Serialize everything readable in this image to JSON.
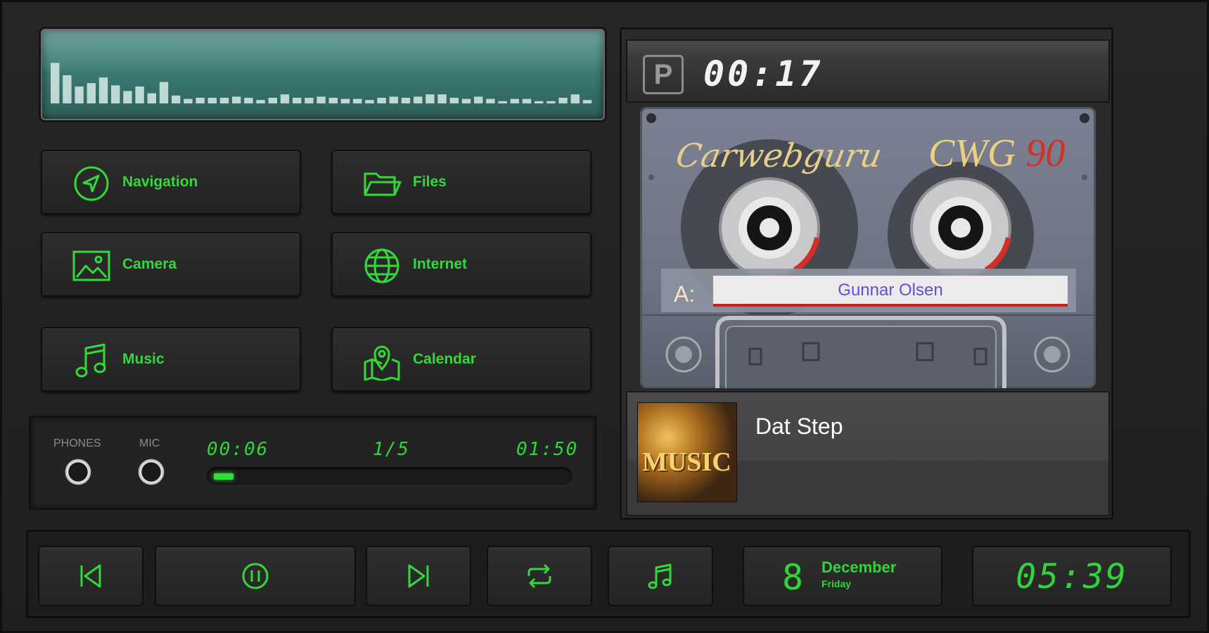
{
  "menu": {
    "navigation": "Navigation",
    "files": "Files",
    "camera": "Camera",
    "internet": "Internet",
    "music": "Music",
    "calendar": "Calendar"
  },
  "audio": {
    "phones_label": "PHONES",
    "mic_label": "MIC",
    "elapsed": "00:06",
    "track_index": "1/5",
    "duration": "01:50",
    "progress_fraction": 0.055
  },
  "visualizer": {
    "levels": [
      0.72,
      0.5,
      0.3,
      0.36,
      0.46,
      0.32,
      0.22,
      0.3,
      0.18,
      0.38,
      0.14,
      0.08,
      0.1,
      0.1,
      0.1,
      0.12,
      0.1,
      0.06,
      0.1,
      0.16,
      0.1,
      0.1,
      0.12,
      0.1,
      0.08,
      0.08,
      0.06,
      0.1,
      0.12,
      0.1,
      0.12,
      0.16,
      0.16,
      0.1,
      0.08,
      0.12,
      0.08,
      0.04,
      0.08,
      0.08,
      0.04,
      0.04,
      0.1,
      0.16,
      0.06
    ],
    "bar_color": "#d7ece8"
  },
  "cassette": {
    "mode_badge": "P",
    "counter": "00:17",
    "brand_script": "Carwebguru",
    "brand_model": "CWG",
    "brand_length": "90",
    "side": "A:",
    "label_text": "Gunnar Olsen"
  },
  "now_playing": {
    "title": "Dat Step",
    "album_art_text": "MUSIC"
  },
  "controls": {
    "icons": [
      "skip-previous-icon",
      "pause-icon",
      "skip-next-icon",
      "repeat-icon",
      "music-note-icon"
    ]
  },
  "date": {
    "day": "8",
    "month": "December",
    "weekday": "Friday"
  },
  "clock": {
    "time": "05:39"
  },
  "colors": {
    "accent_green": "#2fd63a",
    "panel_dark": "#1d1d1d",
    "label_red": "#d01d1d",
    "label_text_blue": "#5b52d8"
  }
}
